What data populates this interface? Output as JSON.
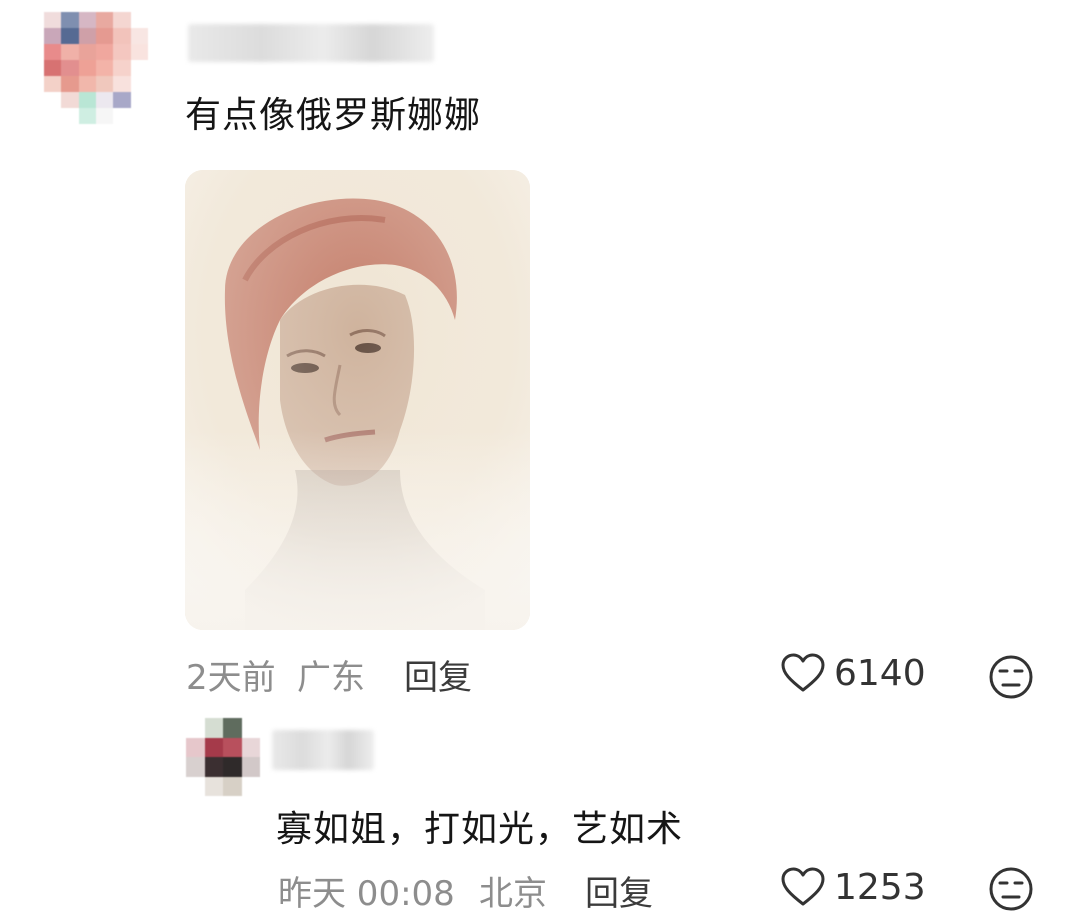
{
  "comment": {
    "text": "有点像俄罗斯娜娜",
    "time": "2天前",
    "location": "广东",
    "reply_label": "回复",
    "likes": "6140"
  },
  "reply": {
    "text": "寡如姐，打如光，艺如术",
    "time": "昨天 00:08",
    "location": "北京",
    "reply_label": "回复",
    "likes": "1253"
  },
  "icons": {
    "like": "heart-outline-icon",
    "dislike": "unamused-face-icon"
  },
  "colors": {
    "meta_text": "#8d8d8d",
    "body_text": "#151515"
  }
}
